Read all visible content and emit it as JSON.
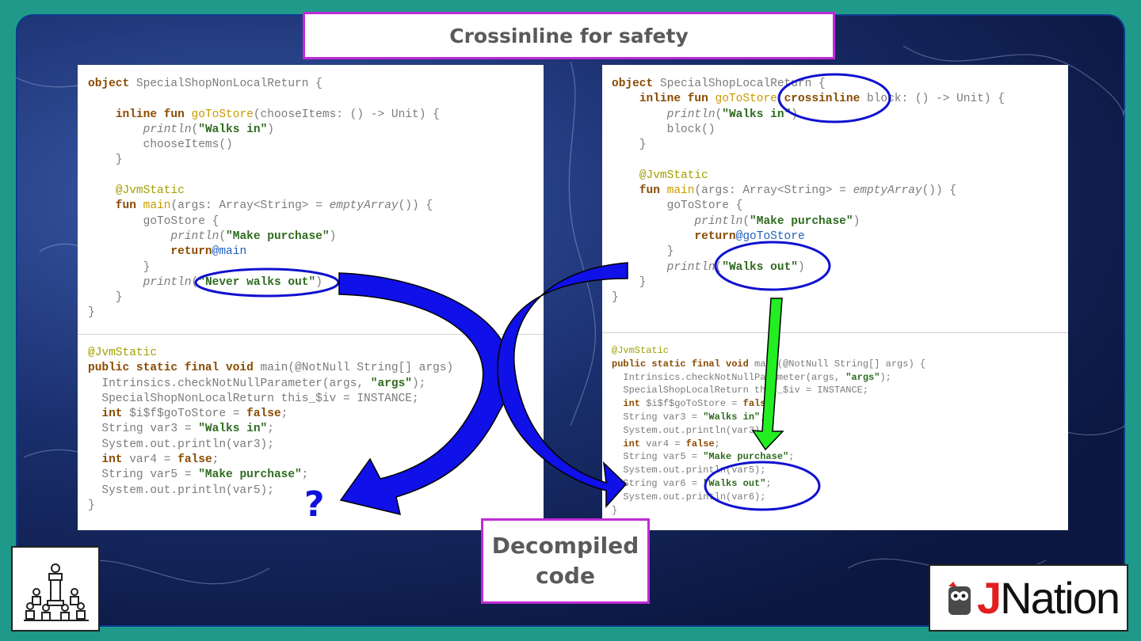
{
  "slide": {
    "title": "Crossinline for safety",
    "decompiled_label_line1": "Decompiled",
    "decompiled_label_line2": "code",
    "question_mark": "?",
    "logo": {
      "j": "J",
      "rest": "Nation"
    }
  },
  "left_kotlin": [
    [
      [
        "kw",
        "object "
      ],
      [
        "",
        "SpecialShopNonLocalReturn {"
      ]
    ],
    [
      [
        "",
        ""
      ]
    ],
    [
      [
        "",
        "    "
      ],
      [
        "kw",
        "inline fun "
      ],
      [
        "fn",
        "goToStore"
      ],
      [
        "",
        "(chooseItems: () -> Unit) {"
      ]
    ],
    [
      [
        "",
        "        "
      ],
      [
        "it",
        "println"
      ],
      [
        "",
        "("
      ],
      [
        "str",
        "\"Walks in\""
      ],
      [
        "",
        ")"
      ]
    ],
    [
      [
        "",
        "        chooseItems()"
      ]
    ],
    [
      [
        "",
        "    }"
      ]
    ],
    [
      [
        "",
        ""
      ]
    ],
    [
      [
        "",
        "    "
      ],
      [
        "ann",
        "@JvmStatic"
      ]
    ],
    [
      [
        "",
        "    "
      ],
      [
        "kw",
        "fun "
      ],
      [
        "fn",
        "main"
      ],
      [
        "",
        "(args: Array<String> = "
      ],
      [
        "it",
        "emptyArray"
      ],
      [
        "",
        "()) {"
      ]
    ],
    [
      [
        "",
        "        goToStore {"
      ]
    ],
    [
      [
        "",
        "            "
      ],
      [
        "it",
        "println"
      ],
      [
        "",
        "("
      ],
      [
        "str",
        "\"Make purchase\""
      ],
      [
        "",
        ")"
      ]
    ],
    [
      [
        "",
        "            "
      ],
      [
        "kw",
        "return"
      ],
      [
        "lbl",
        "@main"
      ]
    ],
    [
      [
        "",
        "        }"
      ]
    ],
    [
      [
        "",
        "        "
      ],
      [
        "it",
        "println"
      ],
      [
        "",
        "("
      ],
      [
        "str",
        "\"Never walks out\""
      ],
      [
        "",
        ")"
      ]
    ],
    [
      [
        "",
        "    }"
      ]
    ],
    [
      [
        "",
        "}"
      ]
    ]
  ],
  "left_decompiled": [
    [
      [
        "ann",
        "@JvmStatic"
      ]
    ],
    [
      [
        "kw",
        "public static final void "
      ],
      [
        "",
        "main(@NotNull String[] args)"
      ]
    ],
    [
      [
        "",
        "  Intrinsics.checkNotNullParameter(args, "
      ],
      [
        "str",
        "\"args\""
      ],
      [
        "",
        ");"
      ]
    ],
    [
      [
        "",
        "  SpecialShopNonLocalReturn this_$iv = INSTANCE;"
      ]
    ],
    [
      [
        "",
        "  "
      ],
      [
        "kw",
        "int "
      ],
      [
        "",
        "$i$f$goToStore = "
      ],
      [
        "kw",
        "false"
      ],
      [
        "",
        ";"
      ]
    ],
    [
      [
        "",
        "  String var3 = "
      ],
      [
        "str",
        "\"Walks in\""
      ],
      [
        "",
        ";"
      ]
    ],
    [
      [
        "",
        "  System.out.println(var3);"
      ]
    ],
    [
      [
        "",
        "  "
      ],
      [
        "kw",
        "int "
      ],
      [
        "",
        "var4 = "
      ],
      [
        "kw",
        "false"
      ],
      [
        "",
        ";"
      ]
    ],
    [
      [
        "",
        "  String var5 = "
      ],
      [
        "str",
        "\"Make purchase\""
      ],
      [
        "",
        ";"
      ]
    ],
    [
      [
        "",
        "  System.out.println(var5);"
      ]
    ],
    [
      [
        "",
        "}"
      ]
    ]
  ],
  "right_kotlin": [
    [
      [
        "kw",
        "object "
      ],
      [
        "",
        "SpecialShopLocalReturn {"
      ]
    ],
    [
      [
        "",
        "    "
      ],
      [
        "kw",
        "inline fun "
      ],
      [
        "fn",
        "goToStore"
      ],
      [
        "",
        "("
      ],
      [
        "kw",
        "crossinline "
      ],
      [
        "",
        "block: () -> Unit) {"
      ]
    ],
    [
      [
        "",
        "        "
      ],
      [
        "it",
        "println"
      ],
      [
        "",
        "("
      ],
      [
        "str",
        "\"Walks in\""
      ],
      [
        "",
        ")"
      ]
    ],
    [
      [
        "",
        "        block()"
      ]
    ],
    [
      [
        "",
        "    }"
      ]
    ],
    [
      [
        "",
        ""
      ]
    ],
    [
      [
        "",
        "    "
      ],
      [
        "ann",
        "@JvmStatic"
      ]
    ],
    [
      [
        "",
        "    "
      ],
      [
        "kw",
        "fun "
      ],
      [
        "fn",
        "main"
      ],
      [
        "",
        "(args: Array<String> = "
      ],
      [
        "it",
        "emptyArray"
      ],
      [
        "",
        "()) {"
      ]
    ],
    [
      [
        "",
        "        goToStore {"
      ]
    ],
    [
      [
        "",
        "            "
      ],
      [
        "it",
        "println"
      ],
      [
        "",
        "("
      ],
      [
        "str",
        "\"Make purchase\""
      ],
      [
        "",
        ")"
      ]
    ],
    [
      [
        "",
        "            "
      ],
      [
        "kw",
        "return"
      ],
      [
        "lbl",
        "@goToStore"
      ]
    ],
    [
      [
        "",
        "        }"
      ]
    ],
    [
      [
        "",
        "        "
      ],
      [
        "it",
        "println"
      ],
      [
        "",
        "("
      ],
      [
        "str",
        "\"Walks out\""
      ],
      [
        "",
        ")"
      ]
    ],
    [
      [
        "",
        "    }"
      ]
    ],
    [
      [
        "",
        "}"
      ]
    ]
  ],
  "right_decompiled": [
    [
      [
        "ann",
        "@JvmStatic"
      ]
    ],
    [
      [
        "kw",
        "public static final void "
      ],
      [
        "",
        "main(@NotNull String[] args) {"
      ]
    ],
    [
      [
        "",
        "  Intrinsics.checkNotNullParameter(args, "
      ],
      [
        "str",
        "\"args\""
      ],
      [
        "",
        ");"
      ]
    ],
    [
      [
        "",
        "  SpecialShopLocalReturn this_$iv = INSTANCE;"
      ]
    ],
    [
      [
        "",
        "  "
      ],
      [
        "kw",
        "int "
      ],
      [
        "",
        "$i$f$goToStore = "
      ],
      [
        "kw",
        "false"
      ],
      [
        "",
        ";"
      ]
    ],
    [
      [
        "",
        "  String var3 = "
      ],
      [
        "str",
        "\"Walks in\""
      ],
      [
        "",
        ";"
      ]
    ],
    [
      [
        "",
        "  System.out.println(var3);"
      ]
    ],
    [
      [
        "",
        "  "
      ],
      [
        "kw",
        "int "
      ],
      [
        "",
        "var4 = "
      ],
      [
        "kw",
        "false"
      ],
      [
        "",
        ";"
      ]
    ],
    [
      [
        "",
        "  String var5 = "
      ],
      [
        "str",
        "\"Make purchase\""
      ],
      [
        "",
        ";"
      ]
    ],
    [
      [
        "",
        "  System.out.println(var5);"
      ]
    ],
    [
      [
        "",
        "  String var6 = "
      ],
      [
        "str",
        "\"Walks out\""
      ],
      [
        "",
        ";"
      ]
    ],
    [
      [
        "",
        "  System.out.println(var6);"
      ]
    ],
    [
      [
        "",
        "}"
      ]
    ]
  ]
}
